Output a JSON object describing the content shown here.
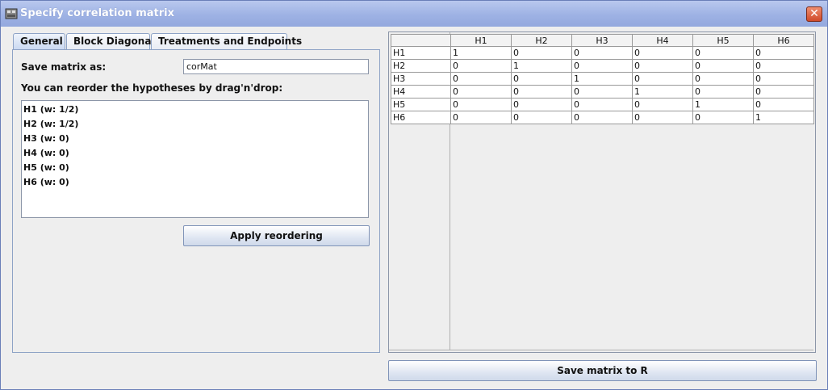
{
  "window": {
    "title": "Specify correlation matrix",
    "close_glyph": "✕",
    "accent_color": "#9eb2e4"
  },
  "tabs": [
    {
      "label": "General",
      "active": true
    },
    {
      "label": "Block Diagonal",
      "active": false
    },
    {
      "label": "Treatments and Endpoints",
      "active": false
    }
  ],
  "general": {
    "save_label": "Save matrix as:",
    "save_value": "corMat",
    "reorder_label": "You can reorder the hypotheses by drag'n'drop:",
    "hypotheses": [
      "H1 (w: 1/2)",
      "H2 (w: 1/2)",
      "H3 (w: 0)",
      "H4 (w: 0)",
      "H5 (w: 0)",
      "H6 (w: 0)"
    ],
    "apply_button": "Apply reordering"
  },
  "matrix": {
    "columns": [
      "H1",
      "H2",
      "H3",
      "H4",
      "H5",
      "H6"
    ],
    "rows": [
      {
        "name": "H1",
        "values": [
          "1",
          "0",
          "0",
          "0",
          "0",
          "0"
        ]
      },
      {
        "name": "H2",
        "values": [
          "0",
          "1",
          "0",
          "0",
          "0",
          "0"
        ]
      },
      {
        "name": "H3",
        "values": [
          "0",
          "0",
          "1",
          "0",
          "0",
          "0"
        ]
      },
      {
        "name": "H4",
        "values": [
          "0",
          "0",
          "0",
          "1",
          "0",
          "0"
        ]
      },
      {
        "name": "H5",
        "values": [
          "0",
          "0",
          "0",
          "0",
          "1",
          "0"
        ]
      },
      {
        "name": "H6",
        "values": [
          "0",
          "0",
          "0",
          "0",
          "0",
          "1"
        ]
      }
    ]
  },
  "save_r_button": "Save matrix to R"
}
